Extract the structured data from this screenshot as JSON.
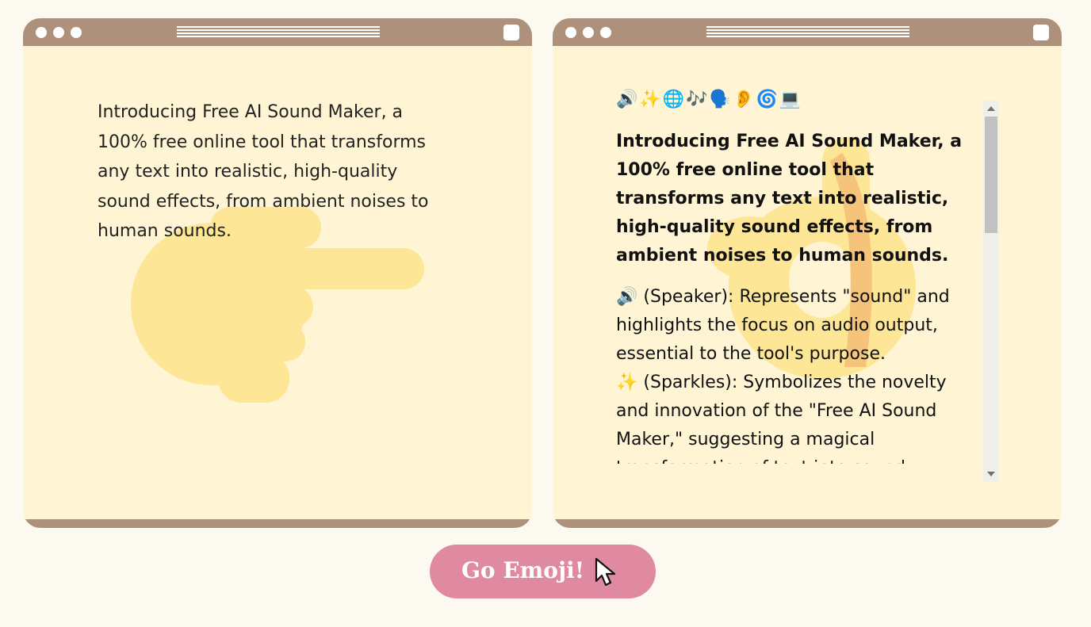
{
  "left_window": {
    "title_icons": [
      "window-dot-icon",
      "window-dot-icon",
      "window-dot-icon",
      "title-grip-icon",
      "window-square-icon"
    ],
    "background_icon": "backhand-index-pointing-right-icon",
    "text": "Introducing Free AI Sound Maker, a 100% free online tool that transforms any text into realistic, high-quality sound effects, from ambient noises to human sounds."
  },
  "right_window": {
    "title_icons": [
      "window-dot-icon",
      "window-dot-icon",
      "window-dot-icon",
      "title-grip-icon",
      "window-square-icon"
    ],
    "background_icon": "ok-hand-icon",
    "emoji_row": [
      {
        "glyph": "🔊",
        "name": "speaker-icon"
      },
      {
        "glyph": "✨",
        "name": "sparkles-icon"
      },
      {
        "glyph": "🌐",
        "name": "globe-icon"
      },
      {
        "glyph": "🎶",
        "name": "musical-notes-icon"
      },
      {
        "glyph": "🗣️",
        "name": "speaking-head-icon"
      },
      {
        "glyph": "👂",
        "name": "ear-icon"
      },
      {
        "glyph": "🌀",
        "name": "cyclone-icon"
      },
      {
        "glyph": "💻",
        "name": "laptop-icon"
      }
    ],
    "bold_intro": "Introducing Free AI Sound Maker, a 100% free online tool that transforms any text into realistic, high-quality sound effects, from ambient noises to human sounds.",
    "descriptions": [
      {
        "glyph": "🔊",
        "text": " (Speaker): Represents \"sound\" and highlights the focus on audio output, essential to the tool's purpose."
      },
      {
        "glyph": "✨",
        "text": " (Sparkles): Symbolizes the novelty and innovation of the \"Free AI Sound Maker,\" suggesting a magical transformation of text into sound."
      }
    ]
  },
  "go_button": {
    "label": "Go Emoji!",
    "icon": "mouse-cursor-icon"
  },
  "colors": {
    "page_background": "#fbf9f0",
    "window_background": "#fff4d3",
    "window_frame": "#ad917a",
    "button": "#df8aa1",
    "hand_yellow": "#fde696",
    "hand_orange": "#f5c47a"
  }
}
